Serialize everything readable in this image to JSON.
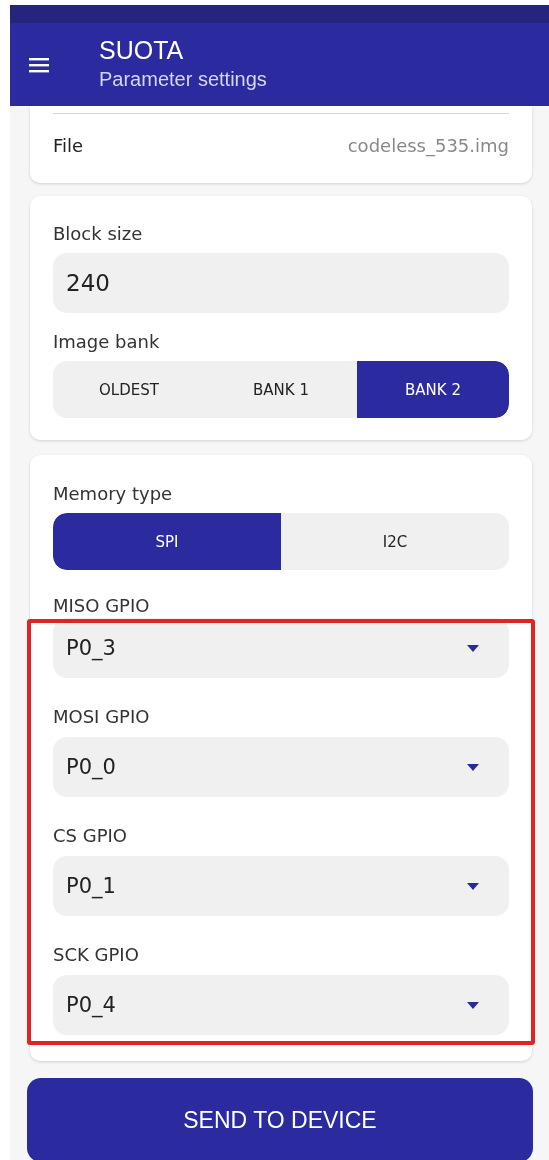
{
  "app_bar": {
    "title": "SUOTA",
    "subtitle": "Parameter settings"
  },
  "file_row": {
    "label": "File",
    "value": "codeless_535.img"
  },
  "block_size": {
    "label": "Block size",
    "value": "240"
  },
  "image_bank": {
    "label": "Image bank",
    "options": [
      {
        "label": "OLDEST",
        "selected": false
      },
      {
        "label": "BANK 1",
        "selected": false
      },
      {
        "label": "BANK 2",
        "selected": true
      }
    ]
  },
  "memory_type": {
    "label": "Memory type",
    "options": [
      {
        "label": "SPI",
        "selected": true
      },
      {
        "label": "I2C",
        "selected": false
      }
    ]
  },
  "gpio_fields": [
    {
      "label": "MISO GPIO",
      "value": "P0_3"
    },
    {
      "label": "MOSI GPIO",
      "value": "P0_0"
    },
    {
      "label": "CS GPIO",
      "value": "P0_1"
    },
    {
      "label": "SCK GPIO",
      "value": "P0_4"
    }
  ],
  "annotation": {
    "kind": "frame"
  },
  "send_button": {
    "label": "SEND TO DEVICE"
  }
}
